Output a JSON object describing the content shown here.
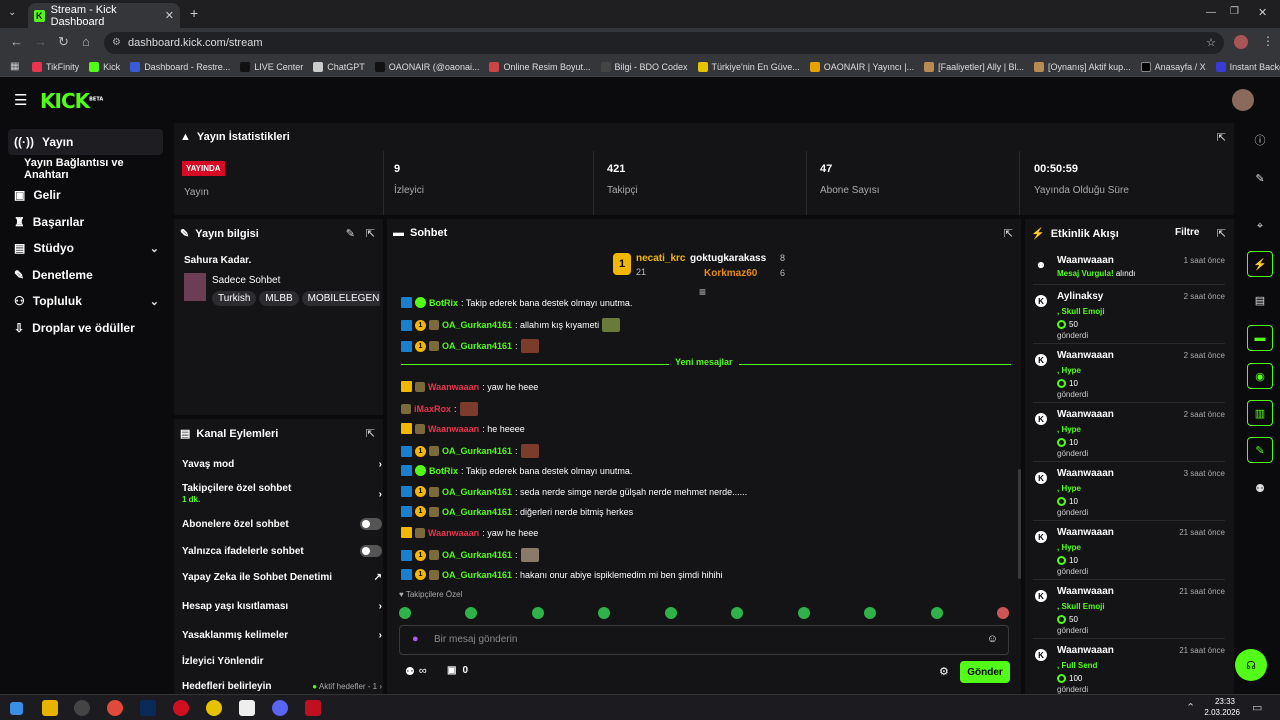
{
  "browser": {
    "tab_title": "Stream - Kick Dashboard",
    "url": "dashboard.kick.com/stream",
    "bookmarks": [
      "TikFinity",
      "Kick",
      "Dashboard - Restre...",
      "LIVE Center",
      "ChatGPT",
      "OAONAIR (@oaonai...",
      "Online Resim Boyut...",
      "Bilgi - BDO Codex",
      "Türkiye'nin En Güve...",
      "OAONAIR | Yayıncı |...",
      "[Faaliyetler] Ally | Bl...",
      "[Oynanış] Aktif kup...",
      "Anasayfa / X",
      "Instant Background..."
    ]
  },
  "app": {
    "logo": "KICK",
    "logo_sup": "BETA"
  },
  "sidebar": {
    "items": [
      {
        "label": "Yayın"
      },
      {
        "label": "Yayın Bağlantısı ve Anahtarı"
      },
      {
        "label": "Gelir"
      },
      {
        "label": "Başarılar"
      },
      {
        "label": "Stüdyo"
      },
      {
        "label": "Denetleme"
      },
      {
        "label": "Topluluk"
      },
      {
        "label": "Droplar ve ödüller"
      }
    ]
  },
  "stats": {
    "title": "Yayın İstatistikleri",
    "live_badge": "YAYINDA",
    "live_label": "Yayın",
    "viewers": "9",
    "viewers_label": "İzleyici",
    "followers": "421",
    "followers_label": "Takipçi",
    "subs": "47",
    "subs_label": "Abone Sayısı",
    "uptime": "00:50:59",
    "uptime_label": "Yayında Olduğu Süre"
  },
  "stream_info": {
    "title": "Yayın bilgisi",
    "stream_title": "Sahura Kadar.",
    "category": "Sadece Sohbet",
    "tags": [
      "Turkish",
      "MLBB",
      "MOBILELEGEN"
    ]
  },
  "channel_actions": {
    "title": "Kanal Eylemleri",
    "slow_mode": "Yavaş mod",
    "followers_chat": "Takipçilere özel sohbet",
    "followers_chat_value": "1 dk.",
    "subs_chat": "Abonelere özel sohbet",
    "emote_chat": "Yalnızca ifadelerle sohbet",
    "ai_mod": "Yapay Zeka ile Sohbet Denetimi",
    "account_age": "Hesap yaşı kısıtlaması",
    "banned_words": "Yasaklanmış kelimeler",
    "viewer_redirect": "İzleyici Yönlendir",
    "goals": "Hedefleri belirleyin",
    "goals_status": "Aktif hedefler - 1"
  },
  "chat": {
    "title": "Sohbet",
    "top_gifter": {
      "rank": "1",
      "name": "necati_krc",
      "count": "21"
    },
    "gifter2": {
      "name": "goktugkarakass",
      "count": "8"
    },
    "gifter3": {
      "name": "Korkmaz60",
      "count": "6"
    },
    "new_messages": "Yeni mesajlar",
    "messages": [
      {
        "user": "BotRix",
        "text": ": Takip ederek bana destek olmayı unutma."
      },
      {
        "user": "OA_Gurkan4161",
        "text": ": allahım kış kıyameti"
      },
      {
        "user": "OA_Gurkan4161",
        "text": ":"
      },
      {
        "user": "Waanwaaan",
        "text": ": yaw he heee"
      },
      {
        "user": "iMaxRox",
        "text": ":"
      },
      {
        "user": "Waanwaaan",
        "text": ": he heeee"
      },
      {
        "user": "OA_Gurkan4161",
        "text": ":"
      },
      {
        "user": "BotRix",
        "text": ": Takip ederek bana destek olmayı unutma."
      },
      {
        "user": "OA_Gurkan4161",
        "text": ": seda nerde simge nerde gülşah nerde mehmet nerde......"
      },
      {
        "user": "OA_Gurkan4161",
        "text": ": diğerleri nerde bitmiş herkes"
      },
      {
        "user": "Waanwaaan",
        "text": ": yaw he heee"
      },
      {
        "user": "OA_Gurkan4161",
        "text": ":"
      },
      {
        "user": "OA_Gurkan4161",
        "text": ": hakanı onur abiye ispiklemedim mi ben şimdi hihihi"
      }
    ],
    "followers_only": "Takipçilere Özel",
    "input_placeholder": "Bir mesaj gönderin",
    "infinity": "∞",
    "points": "0",
    "send": "Gönder"
  },
  "activity": {
    "title": "Etkinlik Akışı",
    "filter": "Filtre",
    "items": [
      {
        "name": "Waanwaaan",
        "time": "1 saat önce",
        "detail": "Mesaj Vurgula!",
        "suffix": " alındı",
        "amount": "",
        "sent": ""
      },
      {
        "name": "Aylinaksy",
        "time": "2 saat önce",
        "detail": ", Skull Emoji",
        "suffix": "",
        "amount": "50",
        "sent": "gönderdi"
      },
      {
        "name": "Waanwaaan",
        "time": "2 saat önce",
        "detail": ", Hype",
        "suffix": "",
        "amount": "10",
        "sent": "gönderdi"
      },
      {
        "name": "Waanwaaan",
        "time": "2 saat önce",
        "detail": ", Hype",
        "suffix": "",
        "amount": "10",
        "sent": "gönderdi"
      },
      {
        "name": "Waanwaaan",
        "time": "3 saat önce",
        "detail": ", Hype",
        "suffix": "",
        "amount": "10",
        "sent": "gönderdi"
      },
      {
        "name": "Waanwaaan",
        "time": "21 saat önce",
        "detail": ", Hype",
        "suffix": "",
        "amount": "10",
        "sent": "gönderdi"
      },
      {
        "name": "Waanwaaan",
        "time": "21 saat önce",
        "detail": ", Skull Emoji",
        "suffix": "",
        "amount": "50",
        "sent": "gönderdi"
      },
      {
        "name": "Waanwaaan",
        "time": "21 saat önce",
        "detail": ", Full Send",
        "suffix": "",
        "amount": "100",
        "sent": "gönderdi"
      }
    ]
  },
  "taskbar": {
    "time": "23:33",
    "date": "2.03.2026"
  }
}
